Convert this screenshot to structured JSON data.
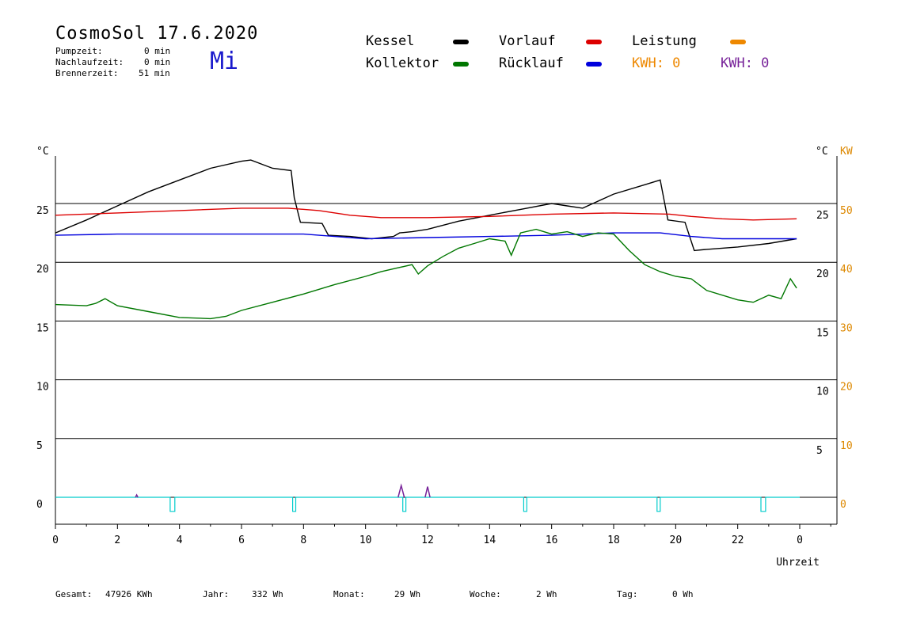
{
  "header": {
    "title": "CosmoSol 17.6.2020",
    "weekday": "Mi",
    "pump_label": "Pumpzeit:",
    "pump_value": "0 min",
    "nachlauf_label": "Nachlaufzeit:",
    "nachlauf_value": "0 min",
    "brenner_label": "Brennerzeit:",
    "brenner_value": "51 min"
  },
  "legend": {
    "kessel": "Kessel",
    "kollektor": "Kollektor",
    "vorlauf": "Vorlauf",
    "ruecklauf": "Rücklauf",
    "leistung": "Leistung",
    "kwh1": "KWH: 0",
    "kwh2": "KWH: 0",
    "colors": {
      "kessel": "#000000",
      "kollektor": "#007700",
      "vorlauf": "#dd0000",
      "ruecklauf": "#0000dd",
      "leistung": "#ee8800",
      "kwh2": "#772299",
      "pump": "#00cccc"
    }
  },
  "footer": {
    "gesamt_label": "Gesamt:",
    "gesamt_value": "47926 KWh",
    "jahr_label": "Jahr:",
    "jahr_value": "332 Wh",
    "monat_label": "Monat:",
    "monat_value": "29 Wh",
    "woche_label": "Woche:",
    "woche_value": "2 Wh",
    "tag_label": "Tag:",
    "tag_value": "0 Wh"
  },
  "chart_data": {
    "type": "line",
    "xlabel": "Uhrzeit",
    "ylabel_left": "°C",
    "ylabel_right_1": "°C",
    "ylabel_right_2": "KW",
    "xlim": [
      0,
      24
    ],
    "ylim": [
      -2.2,
      29.5
    ],
    "grid": true,
    "x_ticks": [
      "0",
      "2",
      "4",
      "6",
      "8",
      "10",
      "12",
      "14",
      "16",
      "18",
      "20",
      "22",
      "0"
    ],
    "y_ticks_left": [
      "0",
      "5",
      "10",
      "15",
      "20",
      "25"
    ],
    "y_ticks_right": [
      "5",
      "10",
      "15",
      "20",
      "25"
    ],
    "y_ticks_kw": [
      "0",
      "10",
      "20",
      "30",
      "40",
      "50"
    ],
    "series": [
      {
        "name": "Kessel",
        "color": "#000000",
        "x": [
          0,
          1,
          2,
          3,
          4,
          5,
          6,
          6.3,
          6.8,
          7.0,
          7.6,
          7.7,
          7.9,
          8.6,
          8.8,
          9.5,
          10.2,
          10.9,
          11.1,
          11.5,
          12.0,
          13.0,
          14.0,
          15.0,
          16.0,
          16.5,
          17.0,
          18.0,
          19.0,
          19.5,
          19.75,
          20.3,
          20.6,
          21.0,
          22.0,
          23.0,
          23.9
        ],
        "y": [
          22.5,
          23.6,
          24.8,
          26.0,
          27.0,
          28.0,
          28.6,
          28.7,
          28.2,
          28.0,
          27.8,
          25.5,
          23.4,
          23.3,
          22.3,
          22.2,
          22.0,
          22.2,
          22.5,
          22.6,
          22.8,
          23.5,
          24.0,
          24.5,
          25.0,
          24.8,
          24.6,
          25.8,
          26.6,
          27.0,
          23.6,
          23.4,
          21.0,
          21.1,
          21.3,
          21.6,
          22.0
        ]
      },
      {
        "name": "Vorlauf",
        "color": "#dd0000",
        "x": [
          0,
          2,
          4,
          6,
          7.5,
          8.5,
          9.5,
          10.5,
          12,
          14,
          16,
          18,
          19.8,
          20.5,
          21.5,
          22.5,
          23.9
        ],
        "y": [
          24.0,
          24.2,
          24.4,
          24.6,
          24.6,
          24.4,
          24.0,
          23.8,
          23.8,
          23.9,
          24.1,
          24.2,
          24.1,
          23.9,
          23.7,
          23.6,
          23.7
        ]
      },
      {
        "name": "Rücklauf",
        "color": "#0000dd",
        "x": [
          0,
          2,
          4,
          6,
          8,
          9,
          10,
          12,
          14,
          16,
          18,
          19.5,
          20.5,
          21.5,
          23.9
        ],
        "y": [
          22.3,
          22.4,
          22.4,
          22.4,
          22.4,
          22.2,
          22.0,
          22.1,
          22.2,
          22.3,
          22.5,
          22.5,
          22.2,
          22.0,
          22.0
        ]
      },
      {
        "name": "Kollektor",
        "color": "#007700",
        "x": [
          0,
          1,
          1.3,
          1.6,
          2,
          3,
          4,
          5,
          5.5,
          6,
          7,
          8,
          9,
          10,
          10.5,
          11,
          11.5,
          11.7,
          12,
          12.5,
          13,
          13.5,
          14,
          14.5,
          14.7,
          15,
          15.5,
          16,
          16.5,
          17,
          17.5,
          18,
          18.5,
          19,
          19.5,
          20,
          20.5,
          21,
          22,
          22.5,
          23,
          23.4,
          23.7,
          23.9
        ],
        "y": [
          16.4,
          16.3,
          16.5,
          16.9,
          16.3,
          15.8,
          15.3,
          15.2,
          15.4,
          15.9,
          16.6,
          17.3,
          18.1,
          18.8,
          19.2,
          19.5,
          19.8,
          19.0,
          19.7,
          20.5,
          21.2,
          21.6,
          22.0,
          21.8,
          20.6,
          22.5,
          22.8,
          22.4,
          22.6,
          22.2,
          22.5,
          22.4,
          21.0,
          19.8,
          19.2,
          18.8,
          18.6,
          17.6,
          16.8,
          16.6,
          17.2,
          16.9,
          18.6,
          17.8
        ]
      },
      {
        "name": "Pumpe",
        "color": "#00cccc",
        "x": [
          0,
          3.7,
          3.7,
          3.85,
          3.85,
          7.65,
          7.65,
          7.75,
          7.75,
          11.2,
          11.2,
          11.3,
          11.3,
          15.1,
          15.1,
          15.2,
          15.2,
          19.4,
          19.4,
          19.5,
          19.5,
          22.75,
          22.75,
          22.9,
          22.9,
          24
        ],
        "y": [
          0,
          0,
          -1.2,
          -1.2,
          0,
          0,
          -1.2,
          -1.2,
          0,
          0,
          -1.2,
          -1.2,
          0,
          0,
          -1.2,
          -1.2,
          0,
          0,
          -1.2,
          -1.2,
          0,
          0,
          -1.2,
          -1.2,
          0,
          0
        ]
      }
    ],
    "kw_spikes": [
      {
        "x": [
          2.58,
          2.62,
          2.66
        ],
        "y": [
          0,
          0.2,
          0
        ]
      },
      {
        "x": [
          11.05,
          11.15,
          11.25
        ],
        "y": [
          0,
          1.0,
          0
        ]
      },
      {
        "x": [
          11.92,
          12.0,
          12.08
        ],
        "y": [
          0,
          0.9,
          0
        ]
      }
    ]
  }
}
